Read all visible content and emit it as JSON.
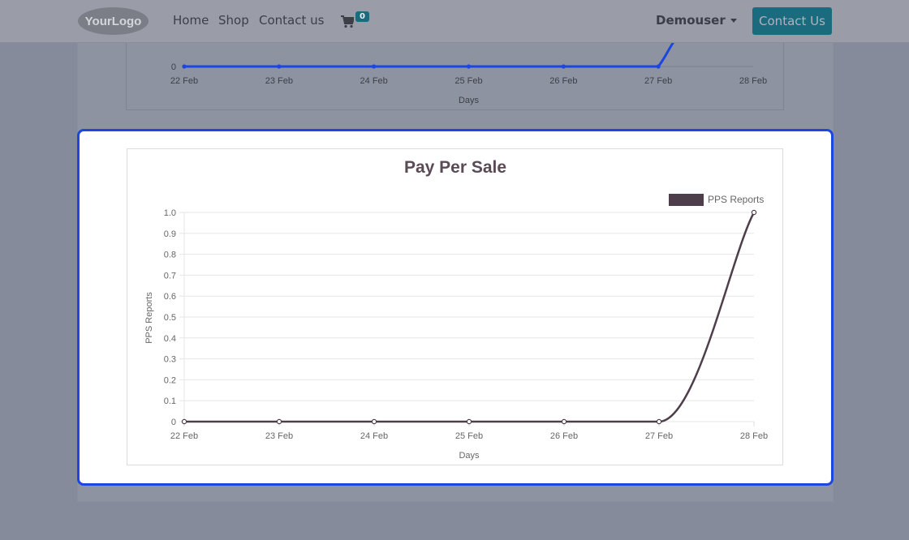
{
  "navbar": {
    "logo_text": "YourLogo",
    "links": [
      "Home",
      "Shop",
      "Contact us"
    ],
    "cart_count": "0",
    "user": "Demouser",
    "contact_button": "Contact Us"
  },
  "colors": {
    "highlight_border": "#1d46e0",
    "pps_line": "#4e3e4b",
    "top_line": "#1d46e0",
    "accent_button": "#1b6b7f"
  },
  "top_chart": {
    "partial": true,
    "xlabel": "Days",
    "categories": [
      "22 Feb",
      "23 Feb",
      "24 Feb",
      "25 Feb",
      "26 Feb",
      "27 Feb",
      "28 Feb"
    ],
    "visible_ytick": "0"
  },
  "chart_data": {
    "type": "line",
    "title": "Pay Per Sale",
    "xlabel": "Days",
    "ylabel": "PPS Reports",
    "categories": [
      "22 Feb",
      "23 Feb",
      "24 Feb",
      "25 Feb",
      "26 Feb",
      "27 Feb",
      "28 Feb"
    ],
    "series": [
      {
        "name": "PPS Reports",
        "values": [
          0,
          0,
          0,
          0,
          0,
          0,
          1
        ]
      }
    ],
    "ylim": [
      0,
      1
    ],
    "yticks": [
      "0",
      "0.1",
      "0.2",
      "0.3",
      "0.4",
      "0.5",
      "0.6",
      "0.7",
      "0.8",
      "0.9",
      "1.0"
    ],
    "legend": "top-right",
    "grid": true
  }
}
